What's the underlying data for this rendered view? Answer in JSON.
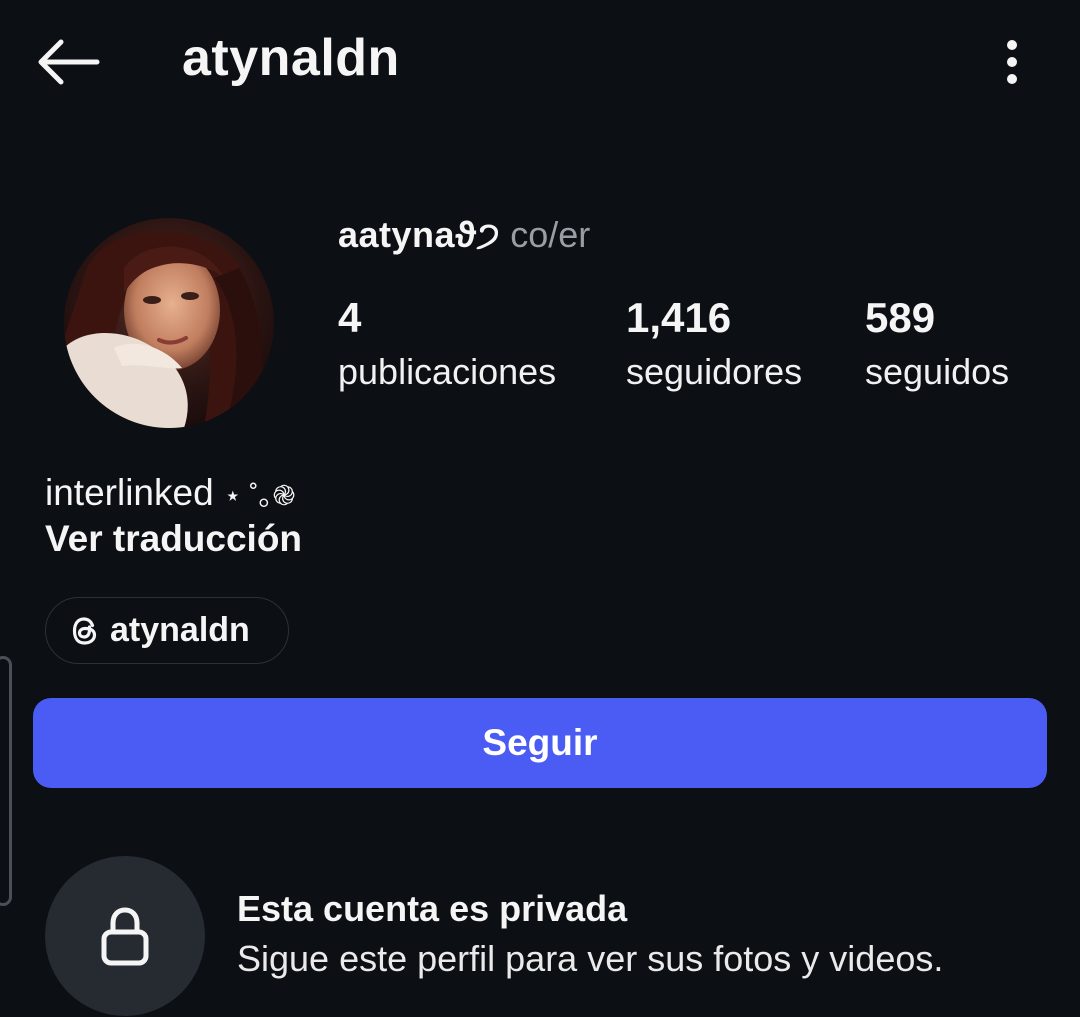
{
  "header": {
    "title": "atynaldn",
    "back_icon": "arrow-left-icon",
    "more_icon": "vertical-ellipsis-icon"
  },
  "profile": {
    "display_name": "aatynaϑ੭",
    "pronouns": "co/er",
    "stats": {
      "posts": {
        "value": "4",
        "label": "publicaciones"
      },
      "followers": {
        "value": "1,416",
        "label": "seguidores"
      },
      "following": {
        "value": "589",
        "label": "seguidos"
      }
    }
  },
  "bio": {
    "text": "interlinked",
    "decoration": "⋆ ˚｡֎",
    "translate_label": "Ver traducción"
  },
  "threads_link": {
    "icon": "threads-icon",
    "label": "atynaldn"
  },
  "actions": {
    "follow_label": "Seguir"
  },
  "private_notice": {
    "icon": "lock-icon",
    "title": "Esta cuenta es privada",
    "subtitle": "Sigue este perfil para ver sus fotos y videos."
  },
  "colors": {
    "background": "#0c0f14",
    "accent": "#4b5cf5",
    "muted_text": "#9a9da3",
    "lock_circle": "#262a31"
  }
}
